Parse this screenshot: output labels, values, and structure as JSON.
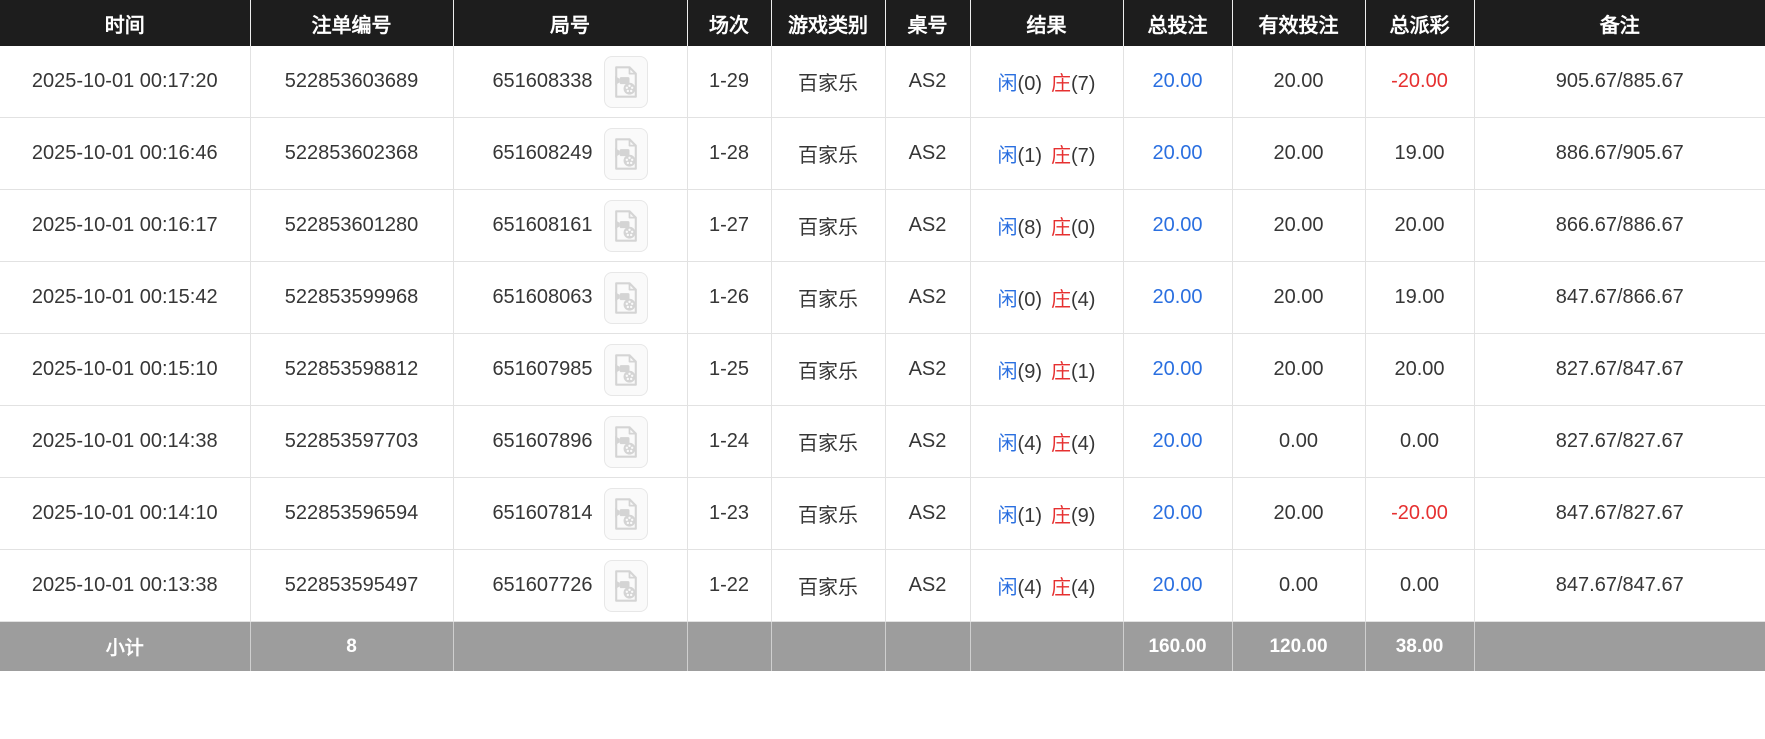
{
  "colors": {
    "header_bg": "#1d1d1d",
    "header_text": "#ffffff",
    "body_text": "#363636",
    "accent_blue": "#2a6fe0",
    "accent_red": "#e63030",
    "subtotal_bg": "#9d9d9d",
    "subtotal_text": "#ffffff",
    "grid_line": "#e2e2e2"
  },
  "table": {
    "columns": [
      {
        "label": "时间"
      },
      {
        "label": "注单编号"
      },
      {
        "label": "局号"
      },
      {
        "label": "场次"
      },
      {
        "label": "游戏类别"
      },
      {
        "label": "桌号"
      },
      {
        "label": "结果"
      },
      {
        "label": "总投注"
      },
      {
        "label": "有效投注"
      },
      {
        "label": "总派彩"
      },
      {
        "label": "备注"
      }
    ],
    "video_icon": "video-file-icon",
    "rows": [
      {
        "time": "2025-10-01 00:17:20",
        "bet_id": "522853603689",
        "round_id": "651608338",
        "session": "1-29",
        "game_type": "百家乐",
        "table_no": "AS2",
        "result_player_label": "闲",
        "result_player_count": "(0)",
        "result_banker_label": "庄",
        "result_banker_count": "(7)",
        "total_bet": "20.00",
        "valid_bet": "20.00",
        "total_payout": "-20.00",
        "remark": "905.67/885.67"
      },
      {
        "time": "2025-10-01 00:16:46",
        "bet_id": "522853602368",
        "round_id": "651608249",
        "session": "1-28",
        "game_type": "百家乐",
        "table_no": "AS2",
        "result_player_label": "闲",
        "result_player_count": "(1)",
        "result_banker_label": "庄",
        "result_banker_count": "(7)",
        "total_bet": "20.00",
        "valid_bet": "20.00",
        "total_payout": "19.00",
        "remark": "886.67/905.67"
      },
      {
        "time": "2025-10-01 00:16:17",
        "bet_id": "522853601280",
        "round_id": "651608161",
        "session": "1-27",
        "game_type": "百家乐",
        "table_no": "AS2",
        "result_player_label": "闲",
        "result_player_count": "(8)",
        "result_banker_label": "庄",
        "result_banker_count": "(0)",
        "total_bet": "20.00",
        "valid_bet": "20.00",
        "total_payout": "20.00",
        "remark": "866.67/886.67"
      },
      {
        "time": "2025-10-01 00:15:42",
        "bet_id": "522853599968",
        "round_id": "651608063",
        "session": "1-26",
        "game_type": "百家乐",
        "table_no": "AS2",
        "result_player_label": "闲",
        "result_player_count": "(0)",
        "result_banker_label": "庄",
        "result_banker_count": "(4)",
        "total_bet": "20.00",
        "valid_bet": "20.00",
        "total_payout": "19.00",
        "remark": "847.67/866.67"
      },
      {
        "time": "2025-10-01 00:15:10",
        "bet_id": "522853598812",
        "round_id": "651607985",
        "session": "1-25",
        "game_type": "百家乐",
        "table_no": "AS2",
        "result_player_label": "闲",
        "result_player_count": "(9)",
        "result_banker_label": "庄",
        "result_banker_count": "(1)",
        "total_bet": "20.00",
        "valid_bet": "20.00",
        "total_payout": "20.00",
        "remark": "827.67/847.67"
      },
      {
        "time": "2025-10-01 00:14:38",
        "bet_id": "522853597703",
        "round_id": "651607896",
        "session": "1-24",
        "game_type": "百家乐",
        "table_no": "AS2",
        "result_player_label": "闲",
        "result_player_count": "(4)",
        "result_banker_label": "庄",
        "result_banker_count": "(4)",
        "total_bet": "20.00",
        "valid_bet": "0.00",
        "total_payout": "0.00",
        "remark": "827.67/827.67"
      },
      {
        "time": "2025-10-01 00:14:10",
        "bet_id": "522853596594",
        "round_id": "651607814",
        "session": "1-23",
        "game_type": "百家乐",
        "table_no": "AS2",
        "result_player_label": "闲",
        "result_player_count": "(1)",
        "result_banker_label": "庄",
        "result_banker_count": "(9)",
        "total_bet": "20.00",
        "valid_bet": "20.00",
        "total_payout": "-20.00",
        "remark": "847.67/827.67"
      },
      {
        "time": "2025-10-01 00:13:38",
        "bet_id": "522853595497",
        "round_id": "651607726",
        "session": "1-22",
        "game_type": "百家乐",
        "table_no": "AS2",
        "result_player_label": "闲",
        "result_player_count": "(4)",
        "result_banker_label": "庄",
        "result_banker_count": "(4)",
        "total_bet": "20.00",
        "valid_bet": "0.00",
        "total_payout": "0.00",
        "remark": "847.67/847.67"
      }
    ],
    "subtotal": {
      "label": "小计",
      "count": "8",
      "total_bet": "160.00",
      "valid_bet": "120.00",
      "total_payout": "38.00"
    }
  }
}
